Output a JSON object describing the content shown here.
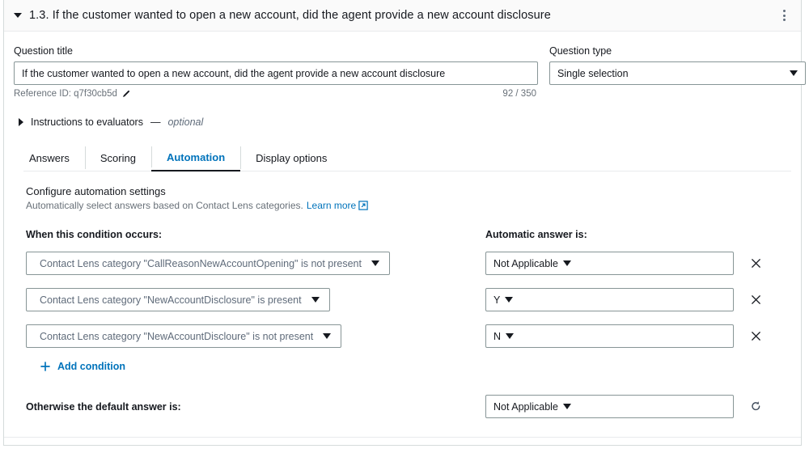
{
  "header": {
    "title": "1.3. If the customer wanted to open a new account, did the agent provide a new account disclosure",
    "collapse_icon": "caret-down-icon",
    "menu_icon": "kebab-menu-icon"
  },
  "question": {
    "title_label": "Question title",
    "title_value": "If the customer wanted to open a new account, did the agent provide a new account disclosure",
    "reference_id": "Reference ID: q7f30cb5d",
    "char_counter": "92 / 350",
    "type_label": "Question type",
    "type_value": "Single selection"
  },
  "instructions": {
    "label": "Instructions to evaluators",
    "dash": " — ",
    "optional": "optional"
  },
  "tabs": [
    {
      "label": "Answers",
      "active": false
    },
    {
      "label": "Scoring",
      "active": false
    },
    {
      "label": "Automation",
      "active": true
    },
    {
      "label": "Display options",
      "active": false
    }
  ],
  "automation": {
    "section_title": "Configure automation settings",
    "section_subtitle": "Automatically select answers based on Contact Lens categories.",
    "learn_more": "Learn more",
    "condition_column_title": "When this condition occurs:",
    "answer_column_title": "Automatic answer is:",
    "conditions": [
      {
        "condition": "Contact Lens category \"CallReasonNewAccountOpening\" is not present",
        "answer": "Not Applicable"
      },
      {
        "condition": "Contact Lens category \"NewAccountDisclosure\" is present",
        "answer": "Y"
      },
      {
        "condition": "Contact Lens category \"NewAccountDiscloure\" is not present",
        "answer": "N"
      }
    ],
    "add_condition": "Add condition",
    "default_label": "Otherwise the default answer is:",
    "default_value": "Not Applicable"
  },
  "colors": {
    "link": "#0073bb",
    "active_tab_underline": "#16191f",
    "text": "#16191f",
    "muted": "#687078",
    "border": "#879596",
    "header_bg": "#fafafa"
  }
}
